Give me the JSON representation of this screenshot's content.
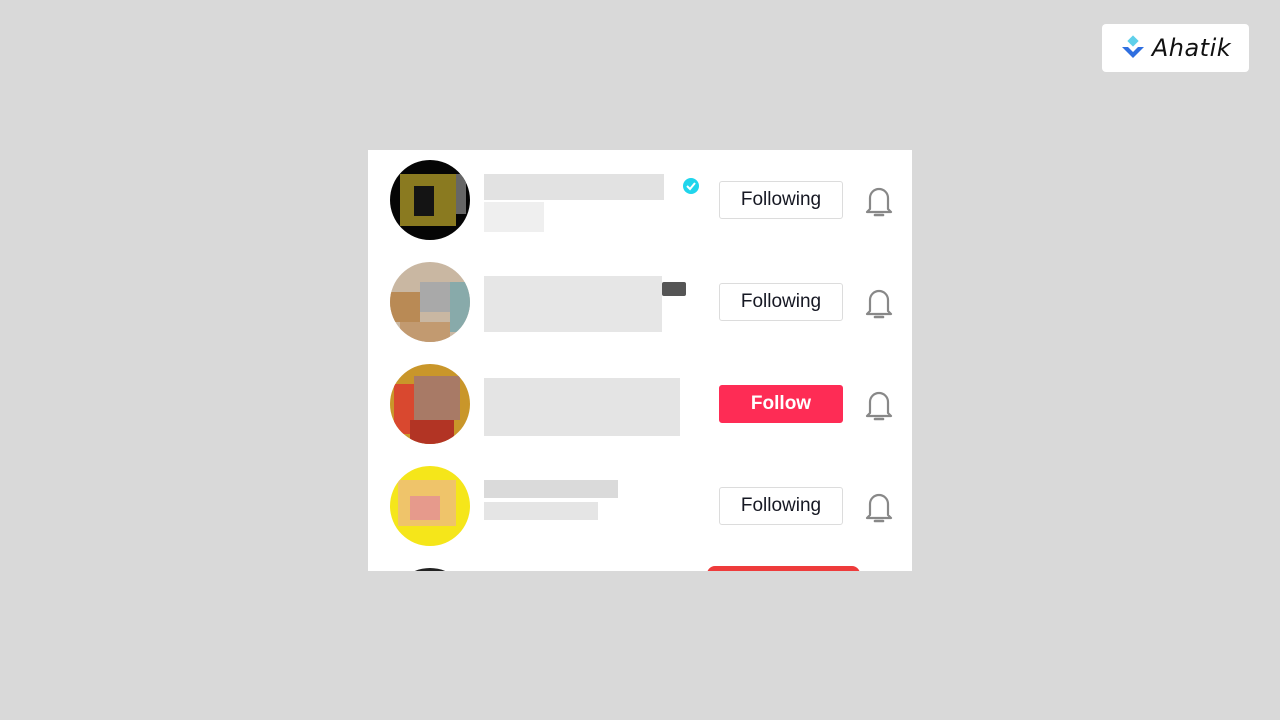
{
  "brand": {
    "name": "Ahatik",
    "logo_icon": "blue-diamond-chevron-icon"
  },
  "list": {
    "rows": [
      {
        "avatar": "blurred-dark-avatar",
        "name_blurred": true,
        "badge": "verified-icon",
        "button_label": "Following",
        "button_state": "following",
        "bell_icon": "bell-icon"
      },
      {
        "avatar": "blurred-photo-avatar",
        "name_blurred": true,
        "badge": "video-camera-icon",
        "button_label": "Following",
        "button_state": "following",
        "bell_icon": "bell-icon"
      },
      {
        "avatar": "blurred-red-avatar",
        "name_blurred": true,
        "badge": "",
        "button_label": "Follow",
        "button_state": "follow",
        "bell_icon": "bell-icon",
        "highlighted": true
      },
      {
        "avatar": "blurred-yellow-avatar",
        "name_blurred": true,
        "badge": "",
        "button_label": "Following",
        "button_state": "following",
        "bell_icon": "bell-icon"
      }
    ]
  },
  "colors": {
    "follow_button": "#fe2c55",
    "highlight_box": "#ee3b3b",
    "verified": "#20d5ec",
    "background": "#d9d9d9"
  }
}
